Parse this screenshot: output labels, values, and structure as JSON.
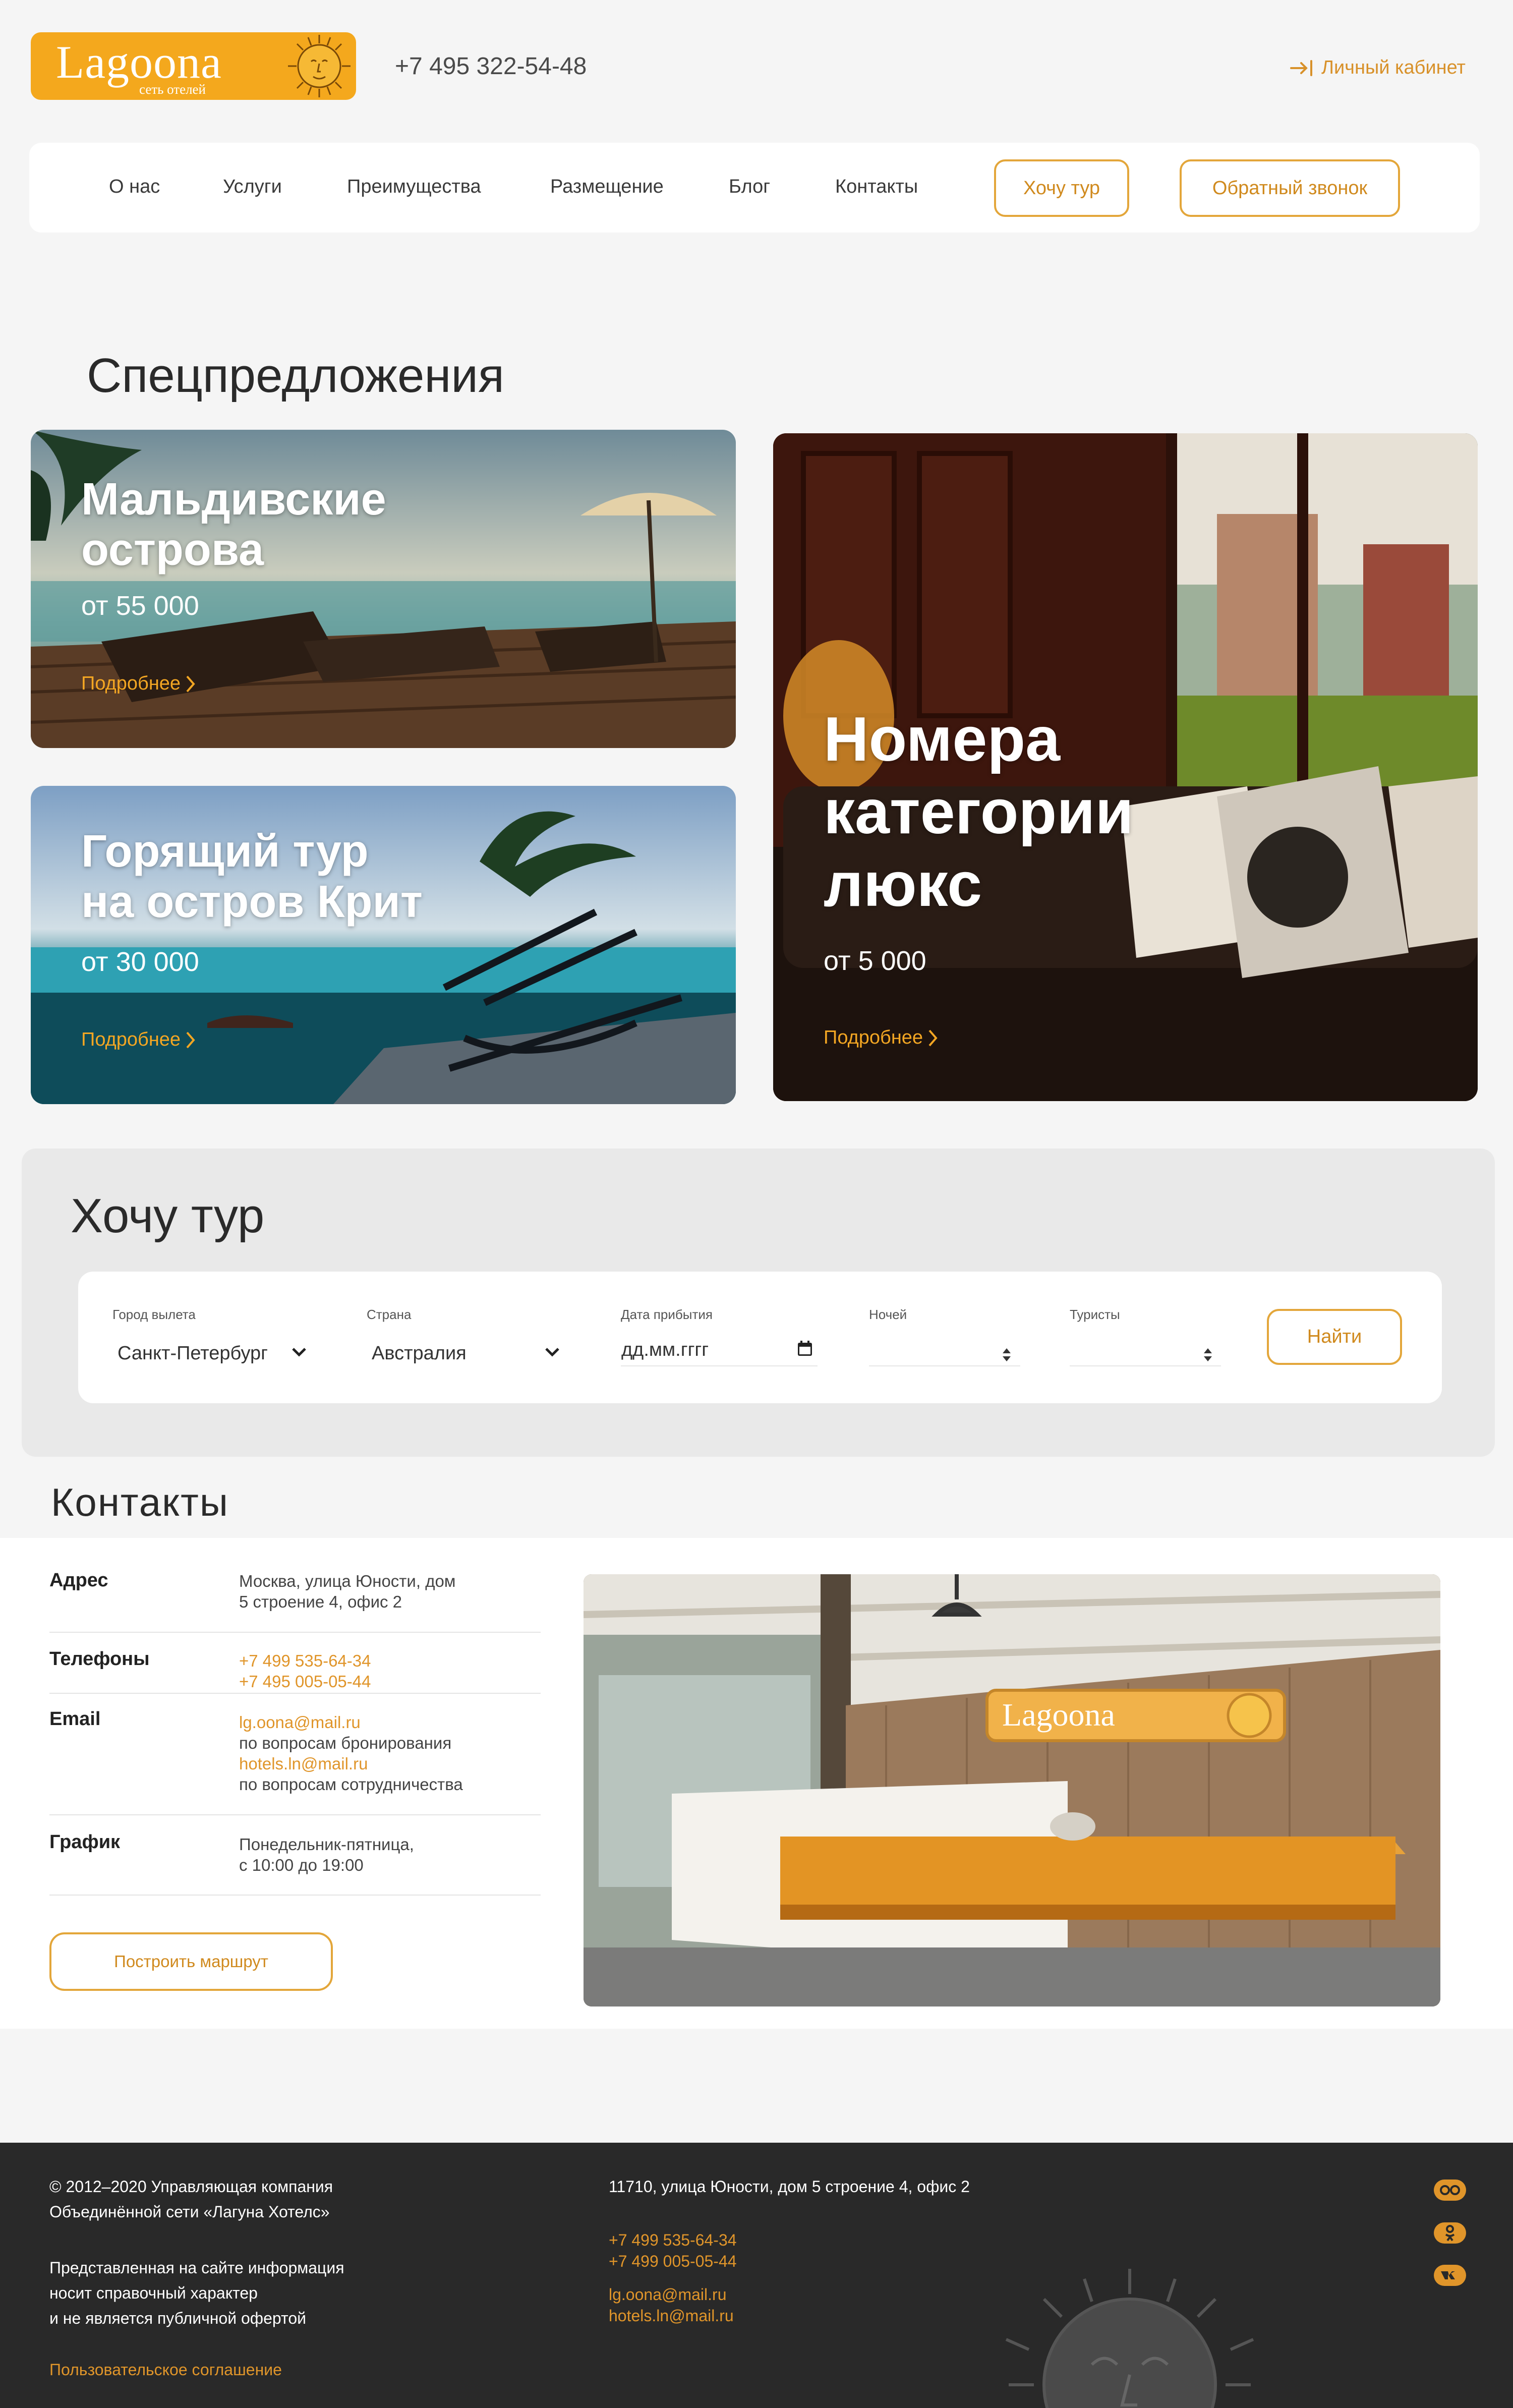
{
  "header": {
    "logo_word": "Lagoona",
    "logo_sub": "сеть отелей",
    "phone": "+7 495 322-54-48",
    "account": "Личный кабинет"
  },
  "nav": {
    "items": [
      "О нас",
      "Услуги",
      "Преимущества",
      "Размещение",
      "Блог",
      "Контакты"
    ],
    "tour_button": "Хочу тур",
    "callback_button": "Обратный звонок"
  },
  "offers": {
    "title": "Спецпредложения",
    "cards": [
      {
        "title_l1": "Мальдивские",
        "title_l2": "острова",
        "price": "от 55 000",
        "more": "Подробнее"
      },
      {
        "title_l1": "Горящий тур",
        "title_l2": "на остров Крит",
        "price": "от 30 000",
        "more": "Подробнее"
      },
      {
        "title_l1": "Номера",
        "title_l2": "категории",
        "title_l3": "люкс",
        "price": "от 5 000",
        "more": "Подробнее"
      }
    ]
  },
  "tour": {
    "title": "Хочу тур",
    "fields": {
      "city_label": "Город вылета",
      "city_value": "Санкт-Петербург",
      "country_label": "Страна",
      "country_value": "Австралия",
      "date_label": "Дата прибытия",
      "date_placeholder": "дд.мм.гггг",
      "nights_label": "Ночей",
      "tourists_label": "Туристы"
    },
    "find_button": "Найти"
  },
  "contacts": {
    "title": "Контакты",
    "address_label": "Адрес",
    "address_l1": "Москва, улица Юности, дом",
    "address_l2": "5 строение 4, офис 2",
    "phones_label": "Телефоны",
    "phone_1": "+7 499 535-64-34",
    "phone_2": "+7 495 005-05-44",
    "email_label": "Email",
    "email_1": "lg.oona@mail.ru",
    "email_1_note": "по вопросам бронирования",
    "email_2": "hotels.ln@mail.ru",
    "email_2_note": "по вопросам сотрудничества",
    "schedule_label": "График",
    "schedule_l1": "Понедельник-пятница,",
    "schedule_l2": "с 10:00 до 19:00",
    "route_button": "Построить маршрут",
    "sign_word": "Lagoona"
  },
  "footer": {
    "copyright_l1": "© 2012–2020 Управляющая компания",
    "copyright_l2": "Объединённой сети «Лагуна Хотелс»",
    "info_l1": "Представленная на сайте информация",
    "info_l2": "носит справочный характер",
    "info_l3": "и не является публичной офертой",
    "agreement": "Пользовательское соглашение",
    "address": "11710, улица Юности, дом 5 строение 4, офис 2",
    "phone_1": "+7 499 535-64-34",
    "phone_2": "+7 499 005-05-44",
    "email_1": "lg.oona@mail.ru",
    "email_2": "hotels.ln@mail.ru",
    "social": [
      "tripadvisor-icon",
      "odnoklassniki-icon",
      "vk-icon"
    ]
  },
  "colors": {
    "accent": "#e0952a",
    "logo_bg": "#f4a81d",
    "footer_bg": "#292929"
  }
}
